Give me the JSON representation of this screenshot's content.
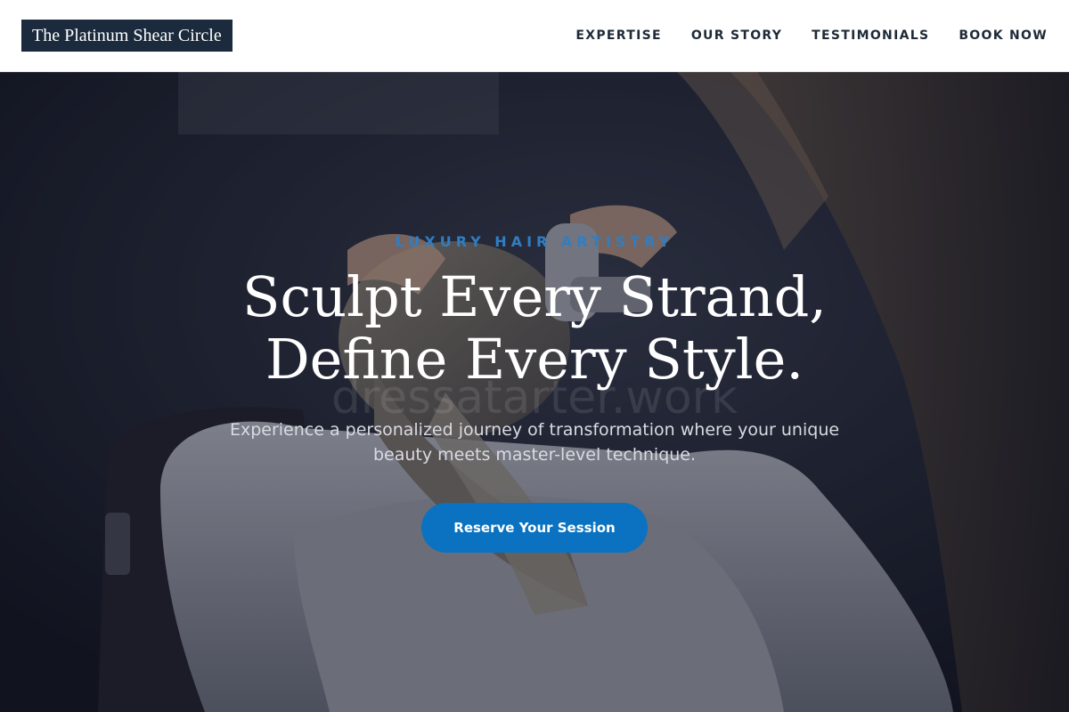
{
  "header": {
    "logo_text": "The Platinum Shear Circle",
    "nav": [
      {
        "label": "EXPERTISE"
      },
      {
        "label": "OUR STORY"
      },
      {
        "label": "TESTIMONIALS"
      },
      {
        "label": "BOOK NOW"
      }
    ]
  },
  "hero": {
    "eyebrow": "LUXURY HAIR ARTISTRY",
    "headline_line1": "Sculpt Every Strand,",
    "headline_line2": "Define Every Style.",
    "subtext": "Experience a personalized journey of transformation where your unique beauty meets master-level technique.",
    "cta_label": "Reserve Your Session",
    "watermark": "dressatarter.work",
    "background_image": "salon hair wash at sink"
  },
  "colors": {
    "logo_bg": "#1b2a3d",
    "accent": "#0a72c0",
    "eyebrow": "#2f7ec4",
    "nav_text": "#1e2a38"
  }
}
